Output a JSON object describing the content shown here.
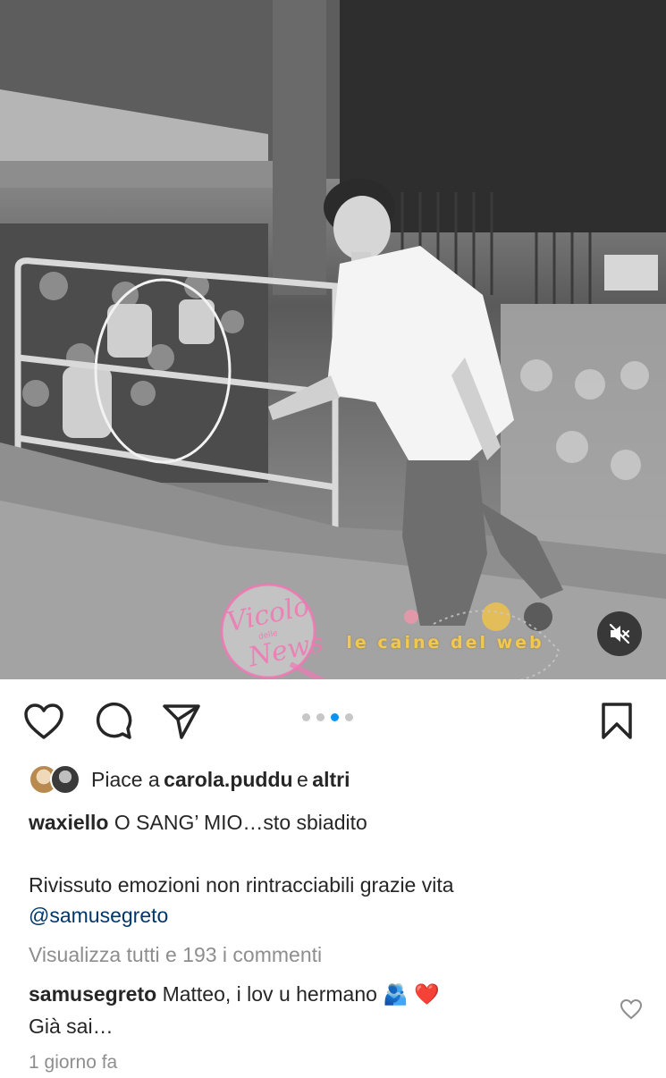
{
  "post": {
    "media": {
      "mute_icon": "speaker-muted-icon",
      "watermark_left": {
        "line1": "Vicolo",
        "line2": "delle",
        "line3": "News"
      },
      "watermark_right": "le caine del web",
      "carousel": {
        "count": 4,
        "active_index": 2
      }
    },
    "actions": {
      "like_icon": "heart-outline-icon",
      "comment_icon": "comment-bubble-icon",
      "share_icon": "paper-plane-icon",
      "save_icon": "bookmark-outline-icon"
    },
    "likes": {
      "prefix": "Piace a",
      "user": "carola.puddu",
      "joiner": "e",
      "others": "altri"
    },
    "caption": {
      "username": "waxiello",
      "line1": "O SANG’ MIO…sto sbiadito",
      "line2": "Rivissuto emozioni non rintracciabili grazie vita",
      "mention": "@samusegreto"
    },
    "view_comments": "Visualizza tutti e 193 i commenti",
    "top_comment": {
      "username": "samusegreto",
      "text": "Matteo, i lov u hermano",
      "emoji": "🫂 ❤️",
      "line2": "Già sai…"
    },
    "timestamp": "1 giorno fa",
    "colors": {
      "accent": "#0095f6",
      "link": "#00376b",
      "muted": "#8e8e8e",
      "text": "#262626",
      "heart": "#ed1c24"
    }
  }
}
